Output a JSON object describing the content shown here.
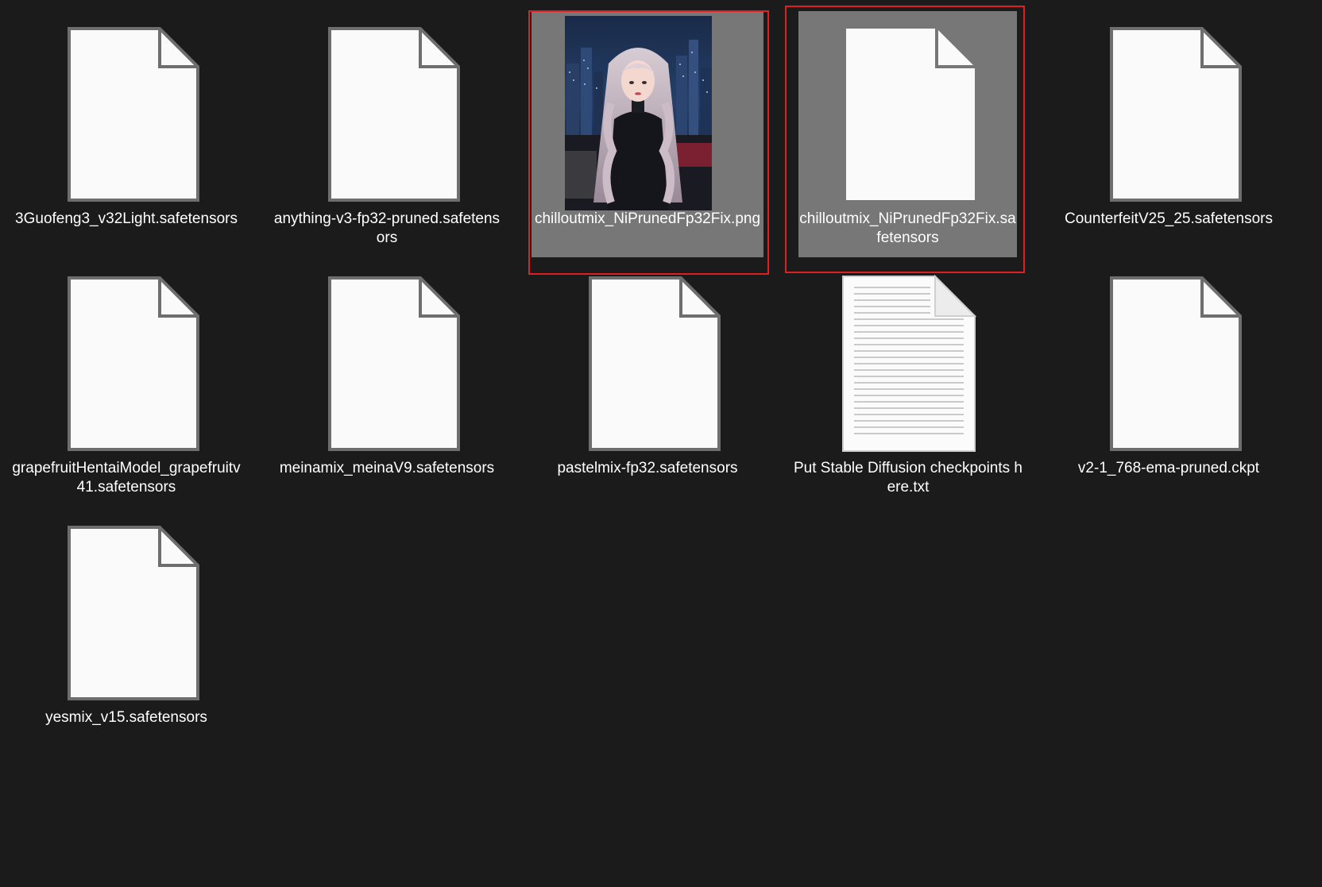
{
  "folder": {
    "items": [
      {
        "name": "3Guofeng3_v32Light.safetensors",
        "icon": "file-icon",
        "selected": false
      },
      {
        "name": "anything-v3-fp32-pruned.safetensors",
        "icon": "file-icon",
        "selected": false
      },
      {
        "name": "chilloutmix_NiPrunedFp32Fix.png",
        "icon": "image-thumbnail",
        "selected": true
      },
      {
        "name": "chilloutmix_NiPrunedFp32Fix.safetensors",
        "icon": "file-icon",
        "selected": true
      },
      {
        "name": "CounterfeitV25_25.safetensors",
        "icon": "file-icon",
        "selected": false
      },
      {
        "name": "grapefruitHentaiModel_grapefruitv41.safetensors",
        "icon": "file-icon",
        "selected": false
      },
      {
        "name": "meinamix_meinaV9.safetensors",
        "icon": "file-icon",
        "selected": false
      },
      {
        "name": "pastelmix-fp32.safetensors",
        "icon": "file-icon",
        "selected": false
      },
      {
        "name": "Put Stable Diffusion checkpoints here.txt",
        "icon": "text-document-icon",
        "selected": false
      },
      {
        "name": "v2-1_768-ema-pruned.ckpt",
        "icon": "file-icon",
        "selected": false
      },
      {
        "name": "yesmix_v15.safetensors",
        "icon": "file-icon",
        "selected": false
      }
    ]
  },
  "colors": {
    "background": "#1b1b1b",
    "selection": "#777777",
    "highlight_frame": "#e02020",
    "label_text": "#ffffff"
  }
}
